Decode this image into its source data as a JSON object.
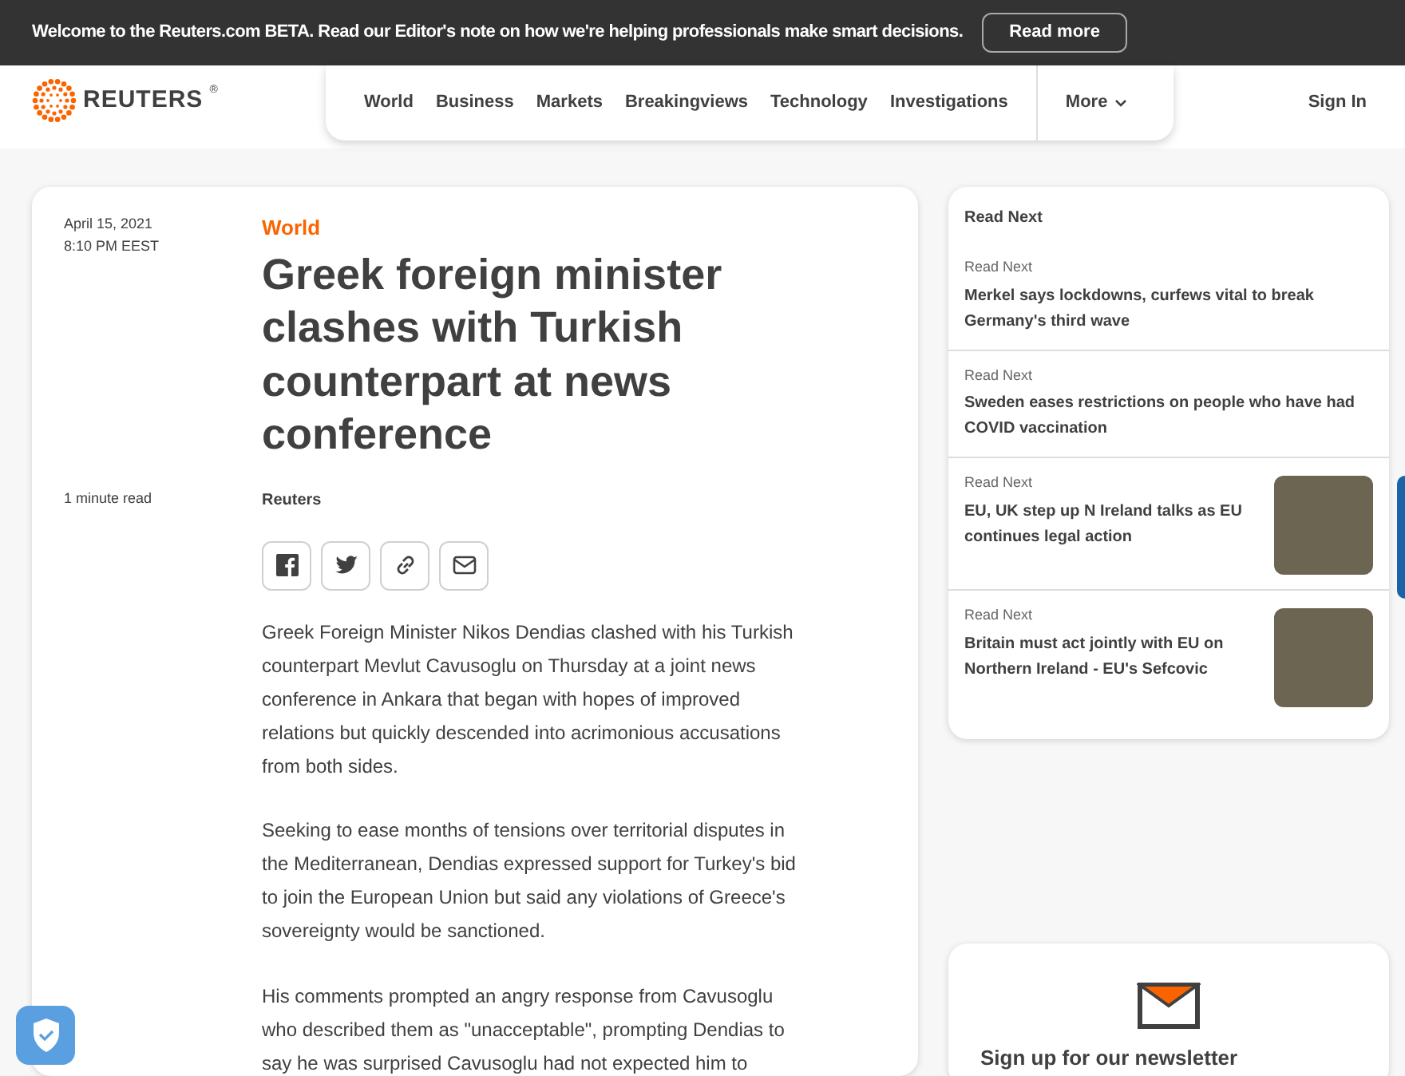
{
  "banner": {
    "message": "Welcome to the Reuters.com BETA. Read our Editor's note on how we're helping professionals make smart decisions.",
    "button": "Read more"
  },
  "header": {
    "logo": "REUTERS",
    "logo_mark": "®",
    "nav": [
      "World",
      "Business",
      "Markets",
      "Breakingviews",
      "Technology",
      "Investigations"
    ],
    "more": "More",
    "sign_in": "Sign In"
  },
  "article": {
    "date": "April 15, 2021",
    "time": "8:10 PM EEST",
    "read_time": "1 minute read",
    "section": "World",
    "headline": "Greek foreign minister clashes with Turkish counterpart at news conference",
    "byline": "Reuters",
    "share": [
      {
        "kind": "facebook"
      },
      {
        "kind": "twitter"
      },
      {
        "kind": "link"
      },
      {
        "kind": "email"
      }
    ],
    "paragraphs": [
      "Greek Foreign Minister Nikos Dendias clashed with his Turkish counterpart Mevlut Cavusoglu on Thursday at a joint news conference in Ankara that began with hopes of improved relations but quickly descended into acrimonious accusations from both sides.",
      "Seeking to ease months of tensions over territorial disputes in the Mediterranean, Dendias expressed support for Turkey's bid to join the European Union but said any violations of Greece's sovereignty would be sanctioned.",
      "His comments prompted an angry response from Cavusoglu who described them as \"unacceptable\", prompting Dendias to say he was surprised Cavusoglu had not expected him to"
    ]
  },
  "read_next": {
    "title": "Read Next",
    "items": [
      {
        "label": "Read Next",
        "headline": "Merkel says lockdowns, curfews vital to break Germany's third wave",
        "has_photo": false
      },
      {
        "label": "Read Next",
        "headline": "Sweden eases restrictions on people who have had COVID vaccination",
        "has_photo": false
      },
      {
        "label": "Read Next",
        "headline": "EU, UK step up N Ireland talks as EU continues legal action",
        "has_photo": true
      },
      {
        "label": "Read Next",
        "headline": "Britain must act jointly with EU on Northern Ireland - EU's Sefcovic",
        "has_photo": true
      }
    ]
  },
  "newsletter": {
    "title": "Sign up for our newsletter"
  }
}
